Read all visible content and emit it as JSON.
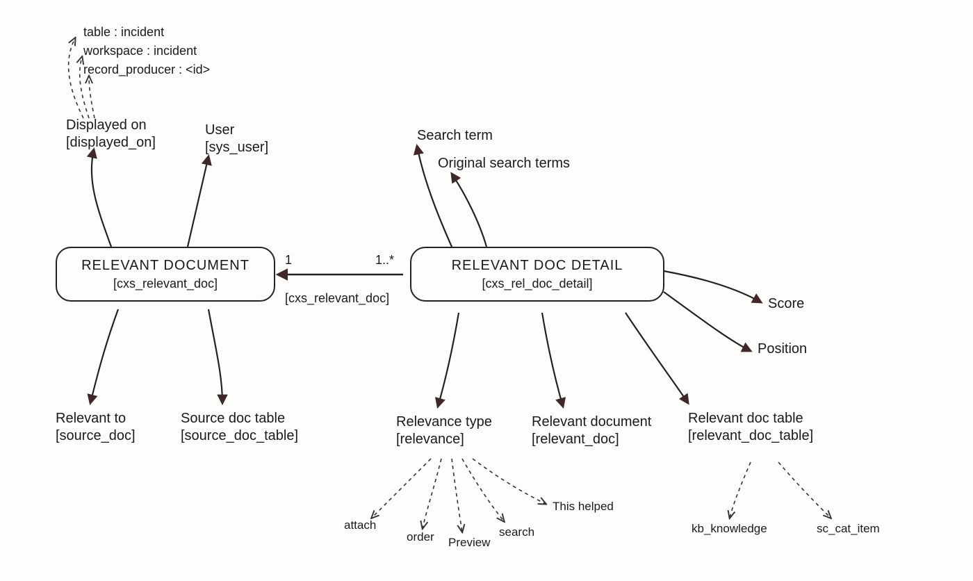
{
  "entities": {
    "relevant_document": {
      "title": "RELEVANT DOCUMENT",
      "table": "[cxs_relevant_doc]"
    },
    "relevant_doc_detail": {
      "title": "RELEVANT DOC DETAIL",
      "table": "[cxs_rel_doc_detail]"
    }
  },
  "relationship": {
    "left_card": "1",
    "right_card": "1..*",
    "via": "[cxs_relevant_doc]"
  },
  "rd_fields": {
    "displayed_on": {
      "label": "Displayed on",
      "col": "[displayed_on]"
    },
    "user": {
      "label": "User",
      "col": "[sys_user]"
    },
    "relevant_to": {
      "label": "Relevant to",
      "col": "[source_doc]"
    },
    "source_table": {
      "label": "Source doc table",
      "col": "[source_doc_table]"
    }
  },
  "displayed_on_examples": {
    "a": "table : incident",
    "b": "workspace : incident",
    "c": "record_producer : <id>"
  },
  "dd_fields": {
    "search_term": "Search term",
    "original_terms": "Original search terms",
    "score": "Score",
    "position": "Position",
    "relevance_type": {
      "label": "Relevance type",
      "col": "[relevance]"
    },
    "relevant_document": {
      "label": "Relevant document",
      "col": "[relevant_doc]"
    },
    "relevant_doc_table": {
      "label": "Relevant doc table",
      "col": "[relevant_doc_table]"
    }
  },
  "relevance_values": {
    "attach": "attach",
    "order": "order",
    "preview": "Preview",
    "search": "search",
    "this_helped": "This helped"
  },
  "doc_table_values": {
    "kb": "kb_knowledge",
    "sc": "sc_cat_item"
  }
}
